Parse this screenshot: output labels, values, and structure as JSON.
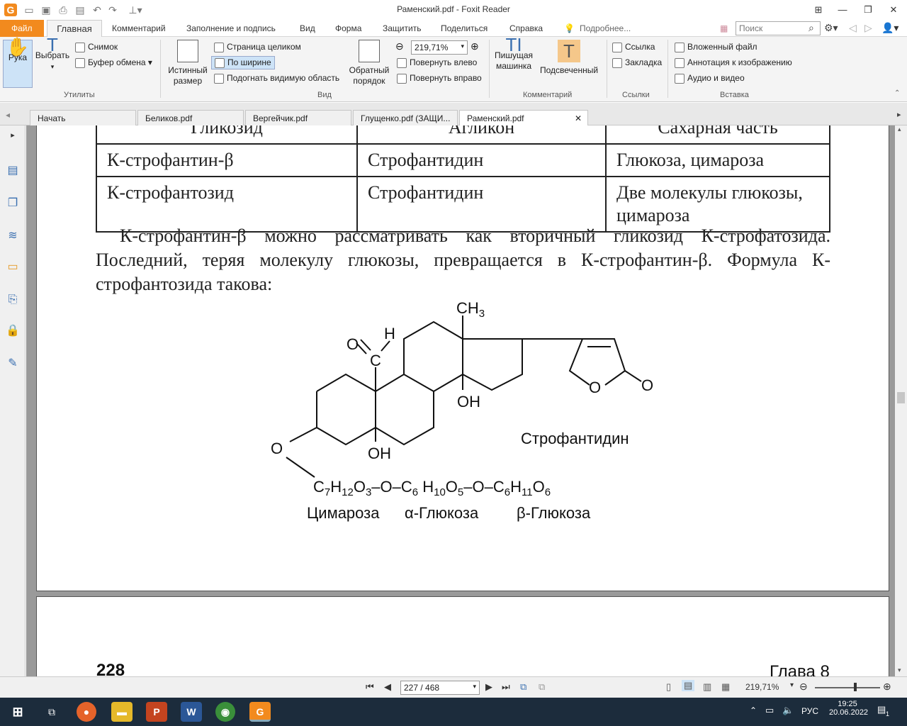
{
  "window": {
    "title": "Раменский.pdf - Foxit Reader"
  },
  "menu": {
    "file": "Файл",
    "items": [
      "Главная",
      "Комментарий",
      "Заполнение и подпись",
      "Вид",
      "Форма",
      "Защитить",
      "Поделиться",
      "Справка"
    ],
    "tell_me": "Подробнее...",
    "search_placeholder": "Поиск"
  },
  "ribbon": {
    "hand": "Рука",
    "select": "Выбрать",
    "snapshot": "Снимок",
    "clipboard": "Буфер обмена",
    "group_utils": "Утилиты",
    "actual_size_1": "Истинный",
    "actual_size_2": "размер",
    "fit_page": "Страница целиком",
    "fit_width": "По ширине",
    "fit_visible": "Подогнать видимую область",
    "reflow_1": "Обратный",
    "reflow_2": "порядок",
    "zoom": "219,71%",
    "rotate_left": "Повернуть влево",
    "rotate_right": "Повернуть вправо",
    "group_view": "Вид",
    "typewriter_1": "Пишущая",
    "typewriter_2": "машинка",
    "highlight": "Подсвеченный",
    "group_comment": "Комментарий",
    "link": "Ссылка",
    "bookmark": "Закладка",
    "group_links": "Ссылки",
    "file_attach": "Вложенный файл",
    "image_annot": "Аннотация к изображению",
    "audio_video": "Аудио и видео",
    "group_insert": "Вставка"
  },
  "tabs": [
    "Начать",
    "Беликов.pdf",
    "Вергейчик.pdf",
    "Глущенко.pdf (ЗАЩИ...",
    "Раменский.pdf"
  ],
  "doc": {
    "header_row": [
      "Гликозид",
      "Агликон",
      "Сахарная часть"
    ],
    "rows": [
      [
        "К-строфантин-β",
        "Строфантидин",
        "Глюкоза, цимароза"
      ],
      [
        "К-строфантозид",
        "Строфантидин",
        "Две молекулы глюкозы, цимароза"
      ]
    ],
    "paragraph": "К-строфантин-β можно рассматривать как вторичный гликозид К-строфатозида. Последний, теряя молекулу глюкозы, превращается в К-строфантин-β. Формула К-строфантозида такова:",
    "formula": {
      "ch3": "CH3",
      "oh1": "OH",
      "oh2": "OH",
      "o_ald": "O",
      "c_ald": "C",
      "h_ald": "H",
      "o_ring": "O",
      "o_keto": "O",
      "o_link": "O",
      "aglycone_label": "Строфантидин",
      "sugar_chain": "C7H12O3–O–C6 H10O5–O–C6H11O6",
      "sugar_labels": [
        "Цимароза",
        "α-Глюкоза",
        "β-Глюкоза"
      ]
    },
    "page_number": "228",
    "chapter": "Глава 8"
  },
  "status": {
    "page_field": "227 / 468",
    "zoom": "219,71%"
  },
  "taskbar": {
    "lang": "РУС",
    "time": "19:25",
    "date": "20.06.2022",
    "notif_count": "1"
  }
}
